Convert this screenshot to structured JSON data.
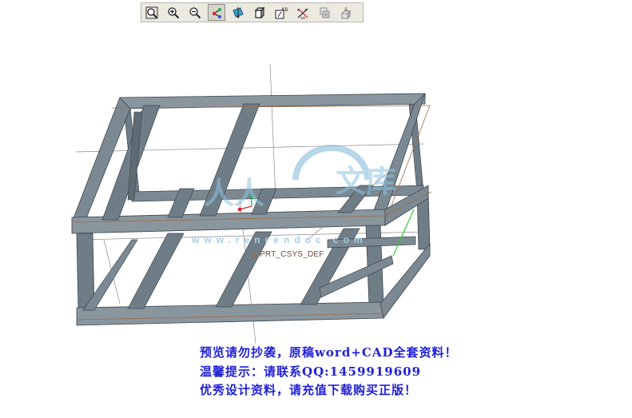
{
  "toolbar": {
    "buttons": [
      {
        "icon": "zoom-fit-icon",
        "active": false
      },
      {
        "icon": "zoom-in-icon",
        "active": false
      },
      {
        "icon": "zoom-out-icon",
        "active": false
      },
      {
        "icon": "datum-csys-icon",
        "active": true
      },
      {
        "icon": "datum-plane-icon",
        "active": false
      },
      {
        "icon": "shaded-cube-icon",
        "active": false
      },
      {
        "icon": "annotation-ab-icon",
        "active": false
      },
      {
        "icon": "datum-points-icon",
        "active": false
      },
      {
        "icon": "copy-geometry-icon",
        "active": false
      },
      {
        "icon": "spin-center-icon",
        "active": false
      }
    ]
  },
  "model": {
    "csys_label": "PRT_CSYS_DEF",
    "frame_color": "#6f7d87",
    "frame_top_color": "#8a969e",
    "edge_color": "#9a6a4a"
  },
  "watermark": {
    "url": "www.renrendoc.com",
    "color": "#a9cfe5"
  },
  "notice": {
    "line1": "预览请勿抄袭，原稿word+CAD全套资料！",
    "line2": "温馨提示：请联系QQ:1459919609",
    "line3": "优秀设计资料，请充值下载购买正版！",
    "color": "#1f1fd8"
  }
}
